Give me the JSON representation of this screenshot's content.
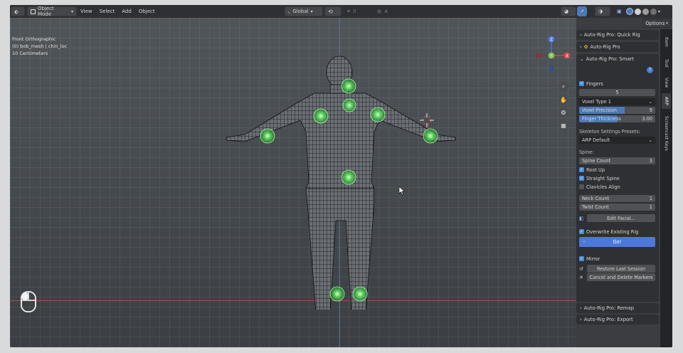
{
  "header": {
    "editor_icon": "⬖",
    "mode": "Object Mode",
    "chevron": "▾",
    "menus": [
      "View",
      "Select",
      "Add",
      "Object"
    ],
    "orientation": "Global",
    "options": "Options"
  },
  "viewport": {
    "view_name": "Front Orthographic",
    "active_object": "(0) bob_mesh | chin_loc",
    "grid_scale": "10 Centimeters"
  },
  "panel": {
    "chevron_right": "›",
    "chevron_down": "⌄",
    "quick_rig": "Auto-Rig Pro: Quick Rig",
    "arp": "Auto-Rig Pro",
    "smart": "Auto-Rig Pro: Smart",
    "remap": "Auto-Rig Pro: Remap",
    "export": "Auto-Rig Pro: Export"
  },
  "smart": {
    "fingers": "Fingers",
    "finger_count": "5",
    "voxel_type": "Voxel Type 1",
    "voxel_precision_label": "Voxel Precision",
    "voxel_precision": "9",
    "finger_thickness_label": "Finger Thickness",
    "finger_thickness": "3.00",
    "skeleton_presets_label": "Skeleton Settings Presets:",
    "skeleton_preset": "ARP Default",
    "spine_label": "Spine:",
    "spine_count_label": "Spine Count",
    "spine_count": "3",
    "root_up": "Root Up",
    "straight_spine": "Straight Spine",
    "clavicles_align": "Clavicles Align",
    "neck_count_label": "Neck Count",
    "neck_count": "1",
    "twist_count_label": "Twist Count",
    "twist_count": "1",
    "edit_facial": "Edit Facial...",
    "overwrite_rig": "Overwrite Existing Rig",
    "go": "Go!",
    "mirror": "Mirror",
    "restore_session": "Restore Last Session",
    "cancel_markers": "Cancel and Delete Markers"
  },
  "tabs": [
    "Item",
    "Tool",
    "View",
    "ARP",
    "Screencast Keys"
  ]
}
